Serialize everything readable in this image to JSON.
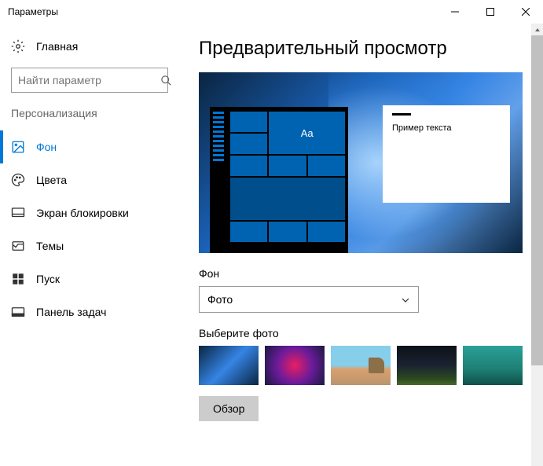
{
  "window": {
    "title": "Параметры"
  },
  "sidebar": {
    "home_label": "Главная",
    "search_placeholder": "Найти параметр",
    "section_title": "Персонализация",
    "items": [
      {
        "label": "Фон",
        "active": true
      },
      {
        "label": "Цвета",
        "active": false
      },
      {
        "label": "Экран блокировки",
        "active": false
      },
      {
        "label": "Темы",
        "active": false
      },
      {
        "label": "Пуск",
        "active": false
      },
      {
        "label": "Панель задач",
        "active": false
      }
    ]
  },
  "content": {
    "page_title": "Предварительный просмотр",
    "preview": {
      "sample_text": "Пример текста",
      "tile_text": "Aa"
    },
    "background_label": "Фон",
    "background_value": "Фото",
    "choose_photo_label": "Выберите фото",
    "browse_label": "Обзор"
  }
}
